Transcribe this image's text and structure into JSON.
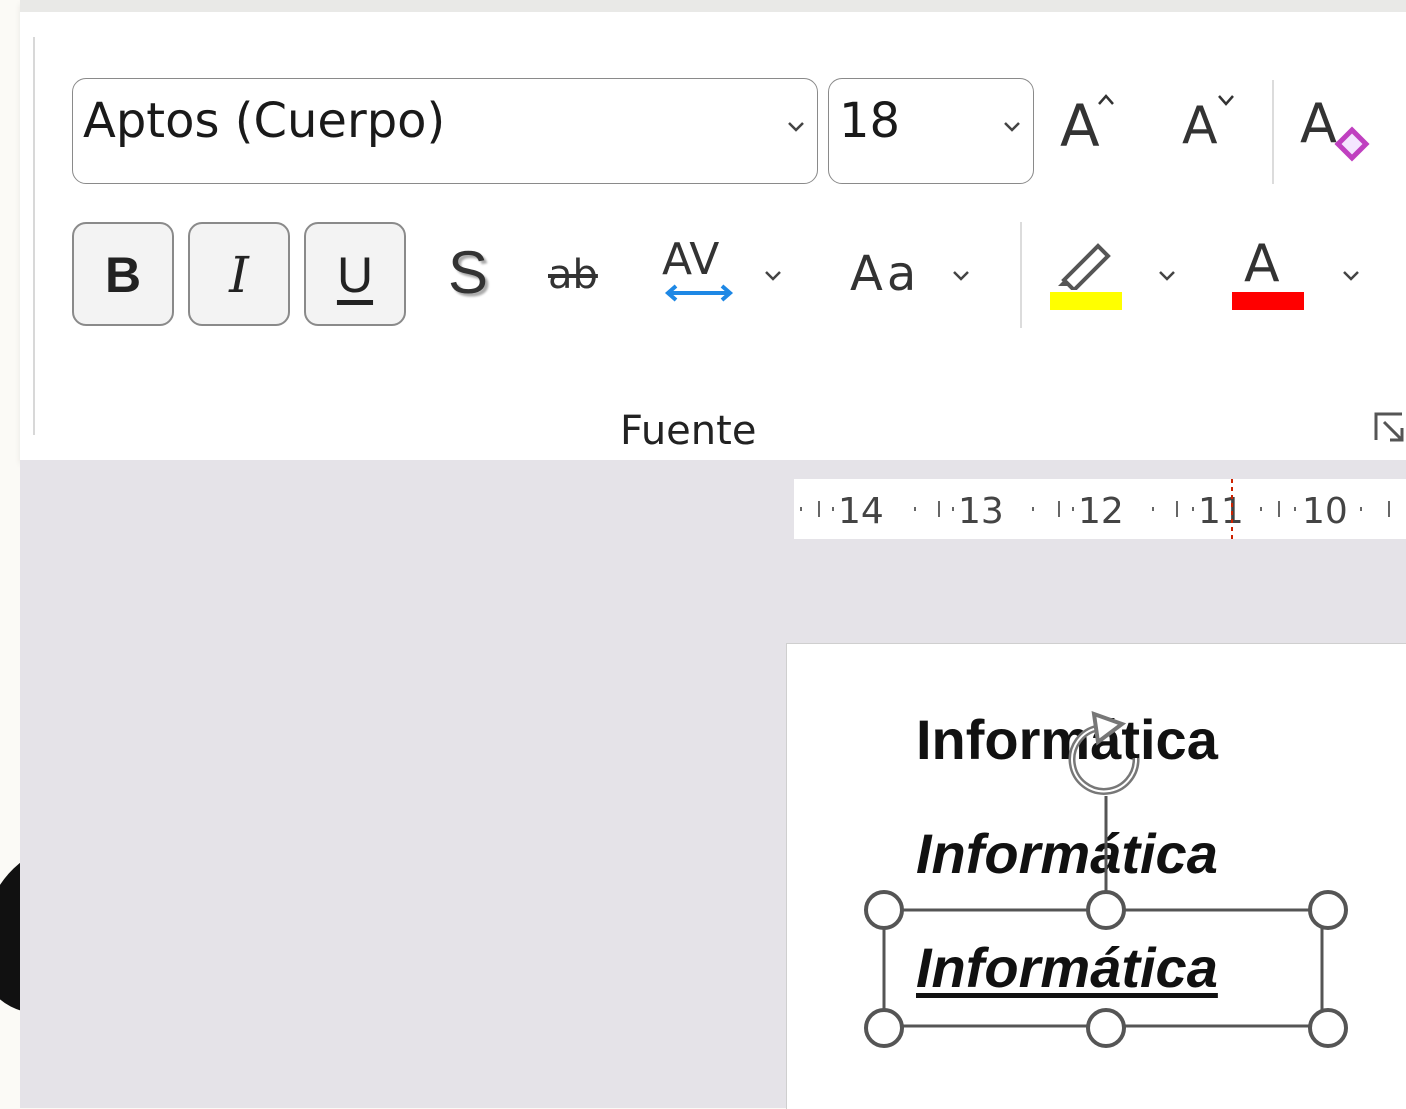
{
  "ribbon": {
    "font_name": "Aptos (Cuerpo)",
    "font_size": "18",
    "group_label": "Fuente",
    "buttons": {
      "bold": "B",
      "italic": "I",
      "underline": "U",
      "shadow": "S",
      "strikethrough": "ab",
      "spacing": "AV",
      "change_case": "Aa",
      "font_color": "A",
      "grow": "A",
      "shrink": "A",
      "clear": "A"
    },
    "colors": {
      "highlight": "#ffff00",
      "font_color": "#ff0000",
      "spacing_arrows": "#1e88e5",
      "clear_eraser": "#c040c0"
    }
  },
  "ruler": {
    "ticks": [
      "14",
      "13",
      "12",
      "11",
      "10"
    ]
  },
  "slide": {
    "lines": [
      "Informática",
      "Informática",
      "Informática"
    ]
  },
  "background_letter": "e"
}
